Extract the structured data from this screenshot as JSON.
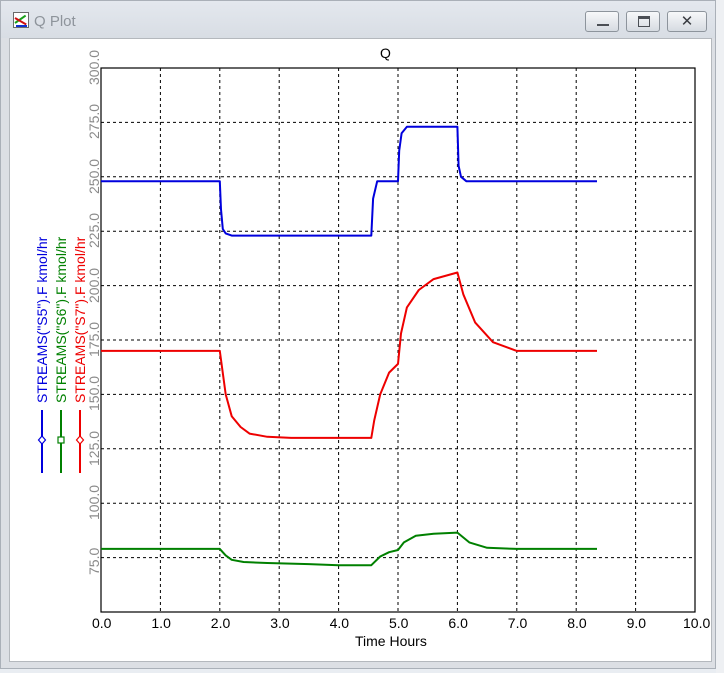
{
  "window": {
    "title": "Q Plot",
    "minimize_icon": "minimize-icon",
    "maximize_icon": "maximize-icon",
    "close_icon": "close-icon",
    "close_glyph": "✕"
  },
  "chart_data": {
    "type": "line",
    "title": "Q",
    "xlabel": "Time Hours",
    "xlim": [
      0,
      10
    ],
    "ylim": [
      50,
      300
    ],
    "grid": true,
    "legend_placement": "left",
    "x_ticks": [
      "0.0",
      "1.0",
      "2.0",
      "3.0",
      "4.0",
      "5.0",
      "6.0",
      "7.0",
      "8.0",
      "9.0",
      "10.0"
    ],
    "y_ticks": [
      "75.0",
      "100.0",
      "125.0",
      "150.0",
      "175.0",
      "200.0",
      "225.0",
      "250.0",
      "275.0",
      "300.0"
    ],
    "series": [
      {
        "name": "STREAMS(\"S5\").F kmol/hr",
        "color": "#0000dd",
        "marker": "diamond",
        "x": [
          0,
          2.0,
          2.02,
          2.05,
          2.1,
          2.2,
          4.55,
          4.58,
          4.65,
          5.0,
          5.02,
          5.06,
          5.15,
          6.0,
          6.02,
          6.06,
          6.15,
          8.35
        ],
        "y": [
          248,
          248,
          235,
          226,
          224,
          223,
          223,
          240,
          248,
          248,
          262,
          270,
          273,
          273,
          255,
          250,
          248,
          248
        ]
      },
      {
        "name": "STREAMS(\"S6\").F kmol/hr",
        "color": "#008000",
        "marker": "square",
        "x": [
          0,
          2.0,
          2.1,
          2.2,
          2.4,
          2.8,
          3.5,
          4.0,
          4.55,
          4.7,
          4.85,
          5.0,
          5.1,
          5.3,
          5.6,
          6.0,
          6.2,
          6.5,
          7.0,
          8.35
        ],
        "y": [
          79,
          79,
          76,
          74,
          73,
          72.5,
          72,
          71.5,
          71.5,
          75.5,
          77.5,
          78.5,
          82,
          85,
          86,
          86.5,
          82,
          79.5,
          79,
          79
        ]
      },
      {
        "name": "STREAMS(\"S7\").F kmol/hr",
        "color": "#ee0000",
        "marker": "diamond",
        "x": [
          0,
          2.0,
          2.1,
          2.2,
          2.35,
          2.5,
          2.8,
          3.2,
          3.8,
          4.55,
          4.6,
          4.7,
          4.85,
          5.0,
          5.05,
          5.15,
          5.35,
          5.6,
          6.0,
          6.1,
          6.3,
          6.6,
          7.0,
          8.35
        ],
        "y": [
          170,
          170,
          150,
          140,
          135,
          132,
          130.5,
          130,
          130,
          130,
          138,
          150,
          160,
          164,
          178,
          190,
          198,
          203,
          206,
          196,
          183,
          174,
          170,
          170
        ]
      }
    ]
  }
}
